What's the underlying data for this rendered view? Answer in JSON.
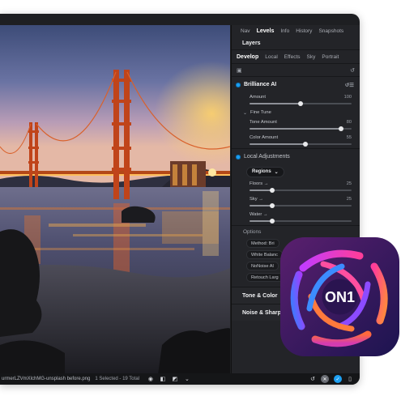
{
  "panel": {
    "top_tabs": [
      "Nav",
      "Levels",
      "Info",
      "History",
      "Snapshots"
    ],
    "active_top_tab": "Levels",
    "layers_title": "Layers",
    "sub_tabs": [
      "Develop",
      "Local",
      "Effects",
      "Sky",
      "Portrait"
    ],
    "active_sub_tab": "Develop",
    "brilliance": {
      "title": "Brilliance AI",
      "amount": {
        "label": "Amount",
        "value": "100",
        "level": 0.5
      },
      "fine_tune_label": "Fine Tune",
      "tone_amount": {
        "label": "Tone Amount",
        "value": "80",
        "level": 0.9
      },
      "color_amount": {
        "label": "Color Amount",
        "value": "55",
        "level": 0.55
      }
    },
    "local_adjustments": {
      "title": "Local Adjustments",
      "regions_label": "Regions",
      "floors": {
        "label": "Floors",
        "arrow": "→",
        "value": "25",
        "level": 0.22
      },
      "sky": {
        "label": "Sky",
        "arrow": "→",
        "value": "25",
        "level": 0.22
      },
      "water": {
        "label": "Water",
        "arrow": "→",
        "value": "",
        "level": 0.22
      }
    },
    "options": {
      "title": "Options",
      "items": [
        "Method: Bri",
        "White Balanc",
        "NoNoise AI",
        "Retouch Larg"
      ]
    },
    "tone_color": "Tone & Color",
    "noise_sharpening": "Noise & Sharpenin"
  },
  "statusbar": {
    "filename": "urmerLZVmXlchMG-unsplash before.png",
    "selection": "1 Selected - 19 Total",
    "icons": [
      "eye-icon",
      "compare-icon",
      "split-view-icon",
      "chevron-down-icon"
    ]
  },
  "colors": {
    "accent": "#1da0f2",
    "panel_bg": "#232428",
    "window_bg": "#1e1f22"
  }
}
